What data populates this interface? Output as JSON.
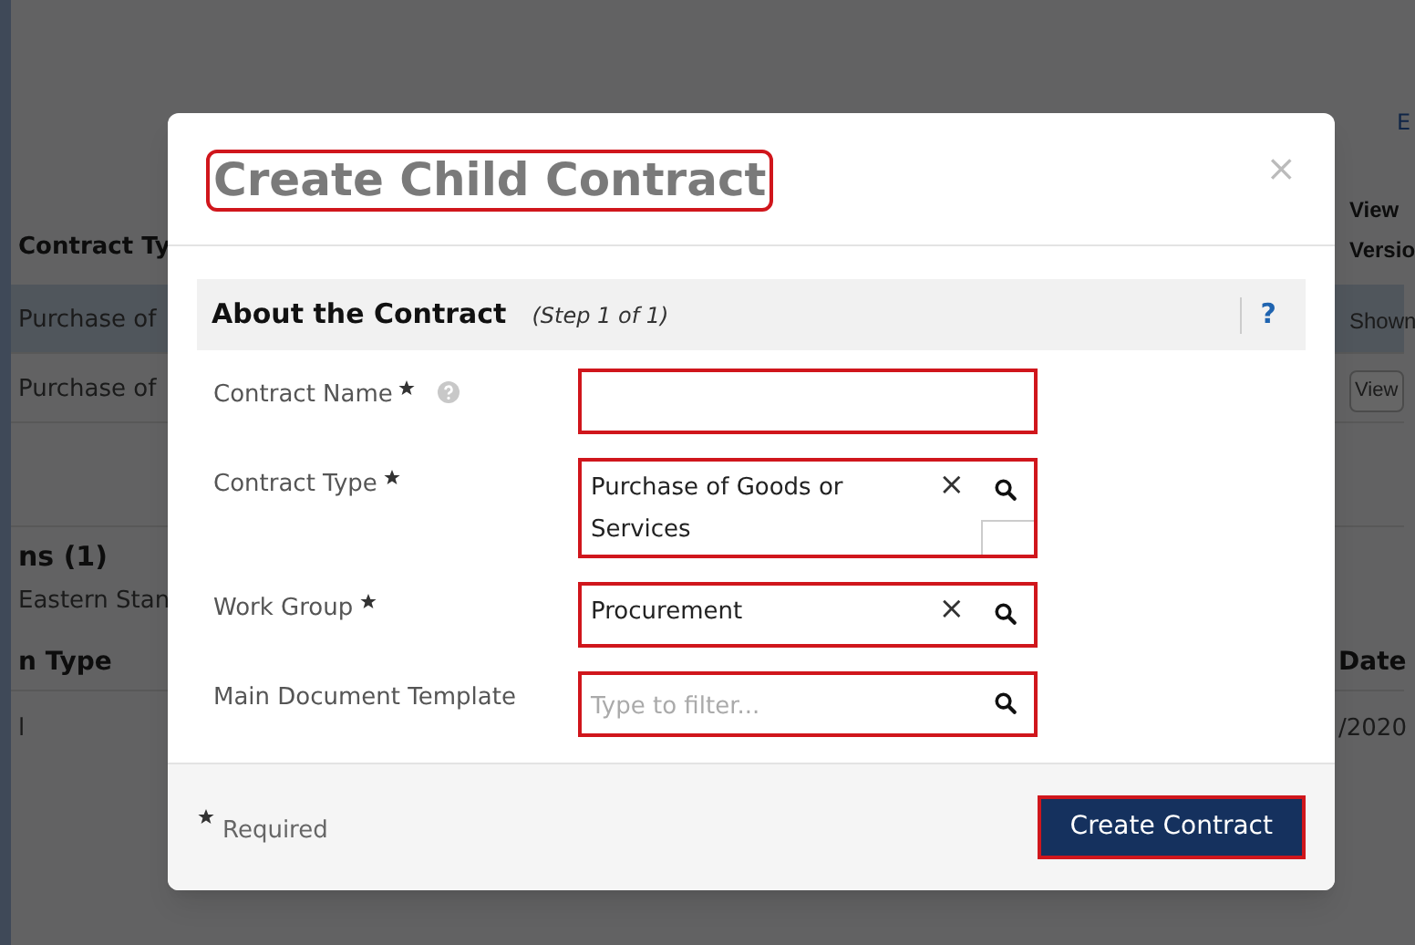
{
  "background_page": {
    "top_link": "E",
    "table_headers": [
      "Contract Ty",
      "View\nVersio"
    ],
    "rows": [
      {
        "cells": [
          "Purchase of",
          "Shown"
        ],
        "selected": true,
        "action": false
      },
      {
        "cells": [
          "Purchase of",
          "View"
        ],
        "selected": false,
        "action": true
      }
    ],
    "section_title": "ns (1)",
    "section_subtitle": "Eastern Stan",
    "lower_headers": [
      "n Type",
      "Date"
    ],
    "lower_cells": [
      "l",
      "/2020"
    ]
  },
  "dialog": {
    "title": "Create Child Contract",
    "close": "×",
    "section": {
      "title": "About the Contract",
      "step": "(Step 1 of 1)",
      "help": "?"
    },
    "fields": [
      {
        "label": "Contract Name",
        "required": true,
        "help": true,
        "clearable": false,
        "search": false
      },
      {
        "label": "Contract Type",
        "required": true,
        "help": false,
        "value": "Purchase of Goods or Services",
        "clear": "×",
        "clearable": true,
        "search": true
      },
      {
        "label": "Work Group",
        "required": true,
        "help": false,
        "value": "Procurement",
        "clear": "×",
        "clearable": true,
        "search": true
      },
      {
        "label": "Main Document Template",
        "required": false,
        "help": false,
        "placeholder": "Type to filter...",
        "clearable": false,
        "search": true
      }
    ],
    "footer": {
      "required_note": "Required",
      "button": "Create Contract"
    }
  }
}
